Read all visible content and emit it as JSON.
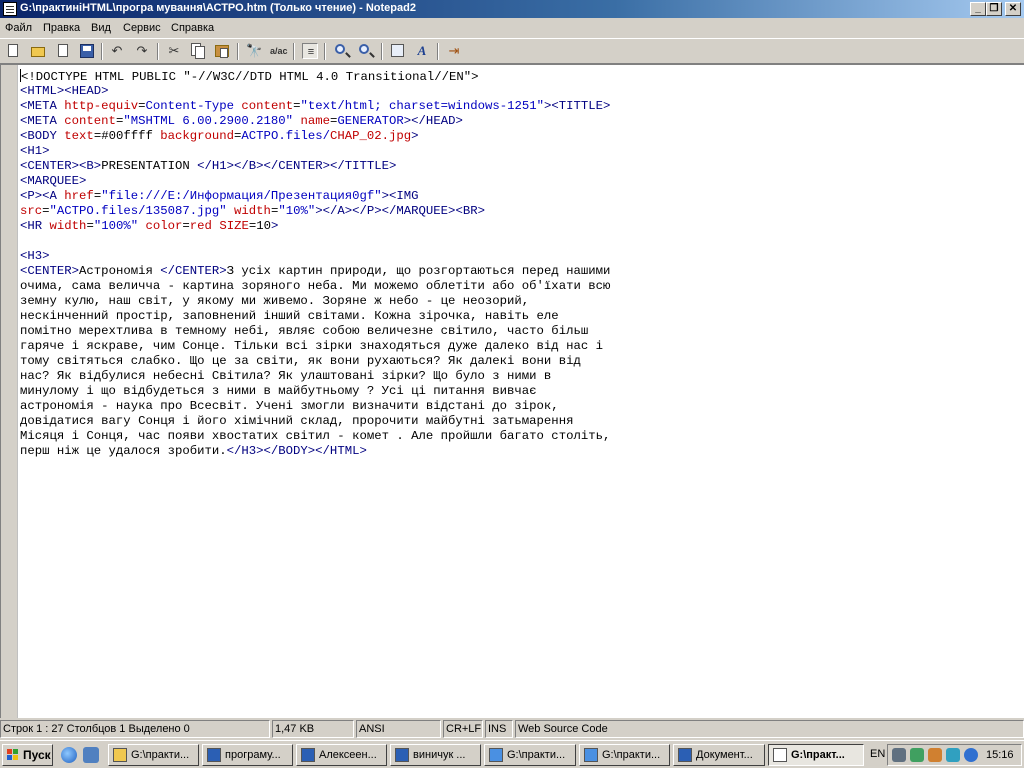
{
  "window": {
    "title": "G:\\практиніHTML\\програ мування\\АСТРО.htm (Только чтение) - Notepad2",
    "minimize_glyph": "_",
    "maximize_glyph": "❐",
    "close_glyph": "✕"
  },
  "menu": [
    "Файл",
    "Правка",
    "Вид",
    "Сервис",
    "Справка"
  ],
  "toolbar": {
    "buttons": [
      "new-icon",
      "open-icon",
      "find-file-icon",
      "save-icon",
      "undo-icon",
      "redo-icon",
      "cut-icon",
      "copy-icon",
      "paste-icon",
      "find-icon",
      "replace-icon",
      "word-wrap-icon",
      "zoom-in-icon",
      "zoom-out-icon",
      "scheme-icon",
      "font-icon",
      "exit-icon"
    ]
  },
  "editor": {
    "lines": [
      [
        [
          "t",
          "<!DOCTYPE HTML PUBLIC \"-//W3C//DTD HTML 4.0 Transitional//EN\">"
        ]
      ],
      [
        [
          "g",
          "<HTML><HEAD>"
        ]
      ],
      [
        [
          "g",
          "<META "
        ],
        [
          "a",
          "http-equiv"
        ],
        [
          "t",
          "="
        ],
        [
          "v",
          "Content-Type"
        ],
        [
          "t",
          " "
        ],
        [
          "a",
          "content"
        ],
        [
          "t",
          "="
        ],
        [
          "v",
          "\"text/html; charset=windows-1251\""
        ],
        [
          "g",
          "><TITTLE>"
        ]
      ],
      [
        [
          "g",
          "<META "
        ],
        [
          "a",
          "content"
        ],
        [
          "t",
          "="
        ],
        [
          "v",
          "\"MSHTML 6.00.2900.2180\""
        ],
        [
          "t",
          " "
        ],
        [
          "a",
          "name"
        ],
        [
          "t",
          "="
        ],
        [
          "v",
          "GENERATOR"
        ],
        [
          "g",
          "></HEAD>"
        ]
      ],
      [
        [
          "g",
          "<BODY "
        ],
        [
          "a",
          "text"
        ],
        [
          "t",
          "=#00ffff "
        ],
        [
          "a",
          "background"
        ],
        [
          "t",
          "="
        ],
        [
          "v",
          "АСТРО.files/"
        ],
        [
          "a",
          "CHAP_02.jpg"
        ],
        [
          "g",
          ">"
        ]
      ],
      [
        [
          "g",
          "<H1>"
        ]
      ],
      [
        [
          "g",
          "<CENTER><B>"
        ],
        [
          "t",
          "PRESENTATION "
        ],
        [
          "g",
          "</H1></B></CENTER></TITTLE>"
        ]
      ],
      [
        [
          "g",
          "<MARQUEE>"
        ]
      ],
      [
        [
          "g",
          "<P><A "
        ],
        [
          "a",
          "href"
        ],
        [
          "t",
          "="
        ],
        [
          "v",
          "\"file:///E:/Информация/Презентация0gf\""
        ],
        [
          "g",
          "><IMG"
        ]
      ],
      [
        [
          "a",
          "src"
        ],
        [
          "t",
          "="
        ],
        [
          "v",
          "\"АСТРО.files/135087.jpg\""
        ],
        [
          "t",
          " "
        ],
        [
          "a",
          "width"
        ],
        [
          "t",
          "="
        ],
        [
          "v",
          "\"10%\""
        ],
        [
          "g",
          "></A></P></MARQUEE><BR>"
        ]
      ],
      [
        [
          "g",
          "<HR "
        ],
        [
          "a",
          "width"
        ],
        [
          "t",
          "="
        ],
        [
          "v",
          "\"100%\""
        ],
        [
          "t",
          " "
        ],
        [
          "a",
          "color"
        ],
        [
          "t",
          "="
        ],
        [
          "a",
          "red"
        ],
        [
          "t",
          " "
        ],
        [
          "a",
          "SIZE"
        ],
        [
          "t",
          "=10"
        ],
        [
          "g",
          ">"
        ]
      ],
      [
        [
          "t",
          ""
        ]
      ],
      [
        [
          "g",
          "<H3>"
        ]
      ],
      [
        [
          "g",
          "<CENTER>"
        ],
        [
          "t",
          "Астрономія "
        ],
        [
          "g",
          "</CENTER>"
        ],
        [
          "t",
          "З усіх картин природи, що розгортаються перед нашими"
        ]
      ],
      [
        [
          "t",
          "очима, сама величча - картина зоряного неба. Ми можемо облетіти або об'їхати всю"
        ]
      ],
      [
        [
          "t",
          "земну кулю, наш світ, у якому ми живемо. Зоряне ж небо - це неозорий,"
        ]
      ],
      [
        [
          "t",
          "нескінченний простір, заповнений інший світами. Кожна зірочка, навіть еле"
        ]
      ],
      [
        [
          "t",
          "помітно мерехтлива в темному небі, являє собою величезне світило, часто більш"
        ]
      ],
      [
        [
          "t",
          "гаряче і яскраве, чим Сонце. Тільки всі зірки знаходяться дуже далеко від нас і"
        ]
      ],
      [
        [
          "t",
          "тому світяться слабко. Що це за світи, як вони рухаються? Як далекі вони від"
        ]
      ],
      [
        [
          "t",
          "нас? Як відбулися небесні Світила? Як улаштовані зірки? Що було з ними в"
        ]
      ],
      [
        [
          "t",
          "минулому і що відбудеться з ними в майбутньому ? Усі ці питання вивчає"
        ]
      ],
      [
        [
          "t",
          "астрономія - наука про Всесвіт. Учені змогли визначити відстані до зірок,"
        ]
      ],
      [
        [
          "t",
          "довідатися вагу Сонця і його хімічний склад, пророчити майбутні затьмарення"
        ]
      ],
      [
        [
          "t",
          "Місяця і Сонця, час появи хвостатих світил - комет . Але пройшли багато століть,"
        ]
      ],
      [
        [
          "t",
          "перш ніж це удалося зробити."
        ],
        [
          "g",
          "</H3></BODY></HTML>"
        ]
      ]
    ]
  },
  "statusbar": {
    "position": "Строк 1 : 27  Столбцов 1  Выделено 0",
    "size": "1,47 KB",
    "encoding": "ANSI",
    "line_endings": "CR+LF",
    "mode": "INS",
    "scheme": "Web Source Code"
  },
  "taskbar": {
    "start_label": "Пуск",
    "tasks": [
      {
        "label": "G:\\практи...",
        "icon": "folder-icon"
      },
      {
        "label": "програму...",
        "icon": "word-icon"
      },
      {
        "label": "Алексеен...",
        "icon": "word-icon"
      },
      {
        "label": "виничук ...",
        "icon": "word-icon"
      },
      {
        "label": "G:\\практи...",
        "icon": "ie-icon"
      },
      {
        "label": "G:\\практи...",
        "icon": "ie-icon"
      },
      {
        "label": "Документ...",
        "icon": "word-icon"
      },
      {
        "label": "G:\\практ...",
        "icon": "notepad-icon",
        "active": true
      }
    ],
    "language": "EN",
    "clock": "15:16"
  }
}
